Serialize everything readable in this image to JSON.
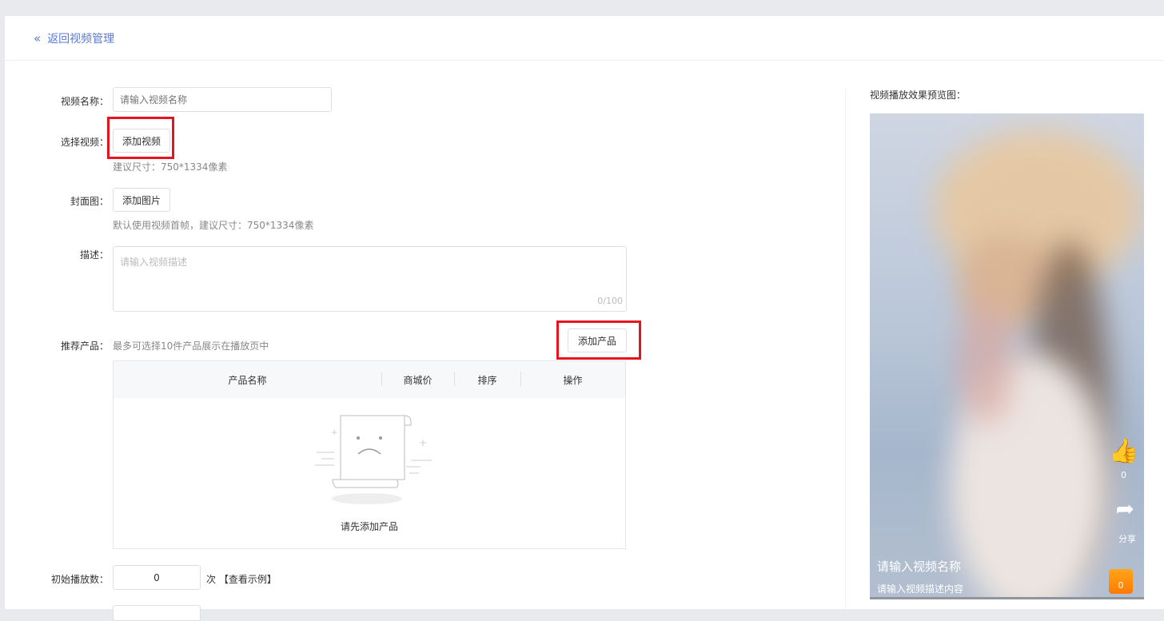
{
  "header": {
    "back_label": "返回视频管理",
    "icon": "double-chevron-left-icon"
  },
  "form": {
    "name_label": "视频名称：",
    "name_placeholder": "请输入视频名称",
    "video_label": "选择视频：",
    "video_button": "添加视频",
    "video_hint": "建议尺寸：750*1334像素",
    "cover_label": "封面图：",
    "cover_button": "添加图片",
    "cover_hint": "默认使用视频首帧，建议尺寸：750*1334像素",
    "desc_label": "描述：",
    "desc_placeholder": "请输入视频描述",
    "desc_count": "0/100",
    "product_label": "推荐产品：",
    "product_hint": "最多可选择10件产品展示在播放页中",
    "product_button": "添加产品",
    "table_headers": [
      "产品名称",
      "商城价",
      "排序",
      "操作"
    ],
    "empty_text": "请先添加产品",
    "plays_label": "初始播放数：",
    "plays_value": "0",
    "plays_unit": "次",
    "plays_example": "【查看示例】"
  },
  "preview": {
    "title": "视频播放效果预览图：",
    "like_count": "0",
    "share_label": "分享",
    "video_name": "请输入视频名称",
    "video_desc": "请输入视频描述内容",
    "cart_count": "0"
  },
  "colors": {
    "accent": "#5a7bd6",
    "highlight": "#e5141f",
    "cart": "#ff8a00"
  }
}
